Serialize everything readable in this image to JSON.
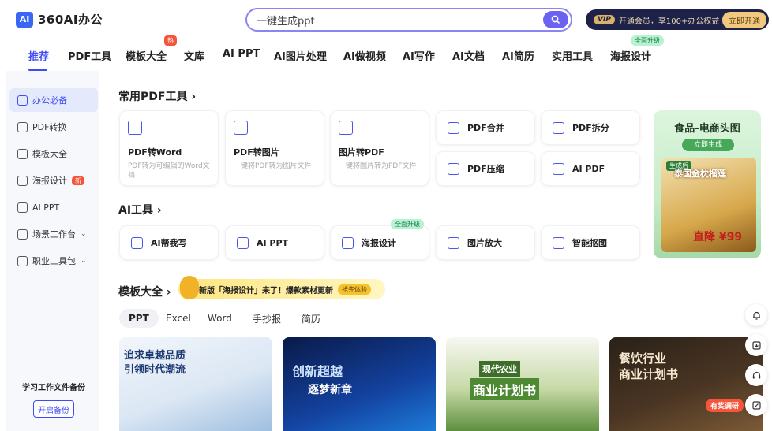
{
  "header": {
    "logo_badge": "AI",
    "logo_text": "360AI办公",
    "search_text": "一键生成ppt",
    "vip_badge": "VIP",
    "vip_text": "开通会员，享100+办公权益",
    "vip_button": "立即开通"
  },
  "nav": {
    "items": [
      "推荐",
      "PDF工具",
      "模板大全",
      "文库",
      "AI PPT",
      "AI图片处理",
      "AI做视频",
      "AI写作",
      "AI文档",
      "AI简历",
      "实用工具",
      "海报设计"
    ],
    "hot_badge": "热",
    "upgrade_badge": "全面升级"
  },
  "sidebar": {
    "items": [
      {
        "label": "办公必备"
      },
      {
        "label": "PDF转换"
      },
      {
        "label": "模板大全"
      },
      {
        "label": "海报设计",
        "tag": "新"
      },
      {
        "label": "AI PPT"
      },
      {
        "label": "场景工作台"
      },
      {
        "label": "职业工具包"
      }
    ],
    "backup_title": "学习工作文件备份",
    "backup_button": "开启备份"
  },
  "pdf_section": {
    "title": "常用PDF工具 ›",
    "big_cards": [
      {
        "title": "PDF转Word",
        "desc": "PDF转为可编辑的Word文档"
      },
      {
        "title": "PDF转图片",
        "desc": "一键将PDF转为图片文件"
      },
      {
        "title": "图片转PDF",
        "desc": "一键将图片转为PDF文件"
      }
    ],
    "small_cards": [
      "PDF合并",
      "PDF拆分",
      "PDF压缩",
      "AI PDF"
    ]
  },
  "ai_section": {
    "title": "AI工具 ›",
    "cards": [
      "AI帮我写",
      "AI PPT",
      "海报设计",
      "图片放大",
      "智能抠图"
    ],
    "upgrade_badge": "全面升级"
  },
  "promo": {
    "title": "食品-电商头图",
    "button": "立即生成",
    "tag": "生成后",
    "headline": "泰国金枕榴莲",
    "price": "直降 ¥99"
  },
  "template_section": {
    "title": "模板大全 ›",
    "announce": "新版「海报设计」来了！爆款素材更新",
    "announce_tag": "抢先体验",
    "filters": [
      "PPT",
      "Excel",
      "Word",
      "手抄报",
      "简历"
    ],
    "thumbnails": [
      {
        "line1": "追求卓越品质",
        "line2": "引领时代潮流"
      },
      {
        "line1": "创新超越",
        "line2": "逐梦新章"
      },
      {
        "line1": "现代农业",
        "line2": "商业计划书"
      },
      {
        "line1": "餐饮行业",
        "line2": "商业计划书",
        "badge": "有奖调研"
      }
    ]
  },
  "floating": {
    "icons": [
      "bell-icon",
      "download-icon",
      "headset-icon",
      "edit-icon"
    ]
  },
  "colors": {
    "accent": "#3f4cf5",
    "vip_bg": "#1e2248",
    "promo_bg": "#dcf5dd"
  }
}
